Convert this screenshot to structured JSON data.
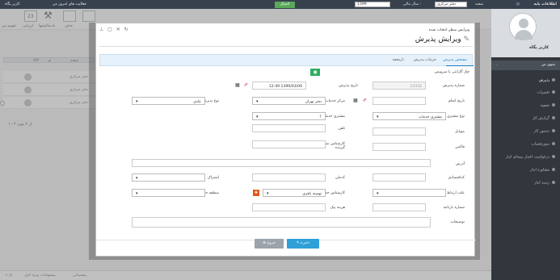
{
  "topbar": {
    "app_title": "اطلاعات پایه",
    "branch_label": "شعبه",
    "branch_value": "دفتر مرکزی",
    "fiscal_label": "سال مالی :",
    "fiscal_value": "1399",
    "green_btn": "اتصال",
    "today_activity": "فعالیت های امروز من",
    "user_short": "کاربر پگاه"
  },
  "sidebar": {
    "username": "کاربر پگاه",
    "menu_title": "منوی من",
    "items": [
      {
        "label": "پذیرش",
        "active": true
      },
      {
        "label": "تعمیرات"
      },
      {
        "label": "تسویه"
      },
      {
        "label": "گزارش کار"
      },
      {
        "label": "دستور کار"
      },
      {
        "label": "صورتحساب"
      },
      {
        "label": "درخواست اعتبار بیمه‌ای انبار"
      },
      {
        "label": "مشاوره انبار"
      },
      {
        "label": "رسید انبار"
      }
    ]
  },
  "toolbar": {
    "tools": [
      "پذیرش جدید",
      "ویرایش",
      "حذف",
      "پادسالمیتها",
      "ارزیابی",
      "تقویم من"
    ],
    "calendar_day": "23"
  },
  "grid": {
    "header": [
      "شعبه",
      "م",
      "VIP"
    ],
    "rows": [
      "دفتر مرکزی",
      "دفتر مرکزی",
      "دفتر مرکزی"
    ],
    "pager": "۱ - ۳ از ۳ مورد"
  },
  "statusbar": {
    "left": "پیشنهادات ویژه لاول",
    "right": "پیشتیبانی"
  },
  "modal": {
    "window_title": "ویرایش سطر انتخاب شده",
    "controls": "⊥ ▢ ✕ ↻",
    "heading": "ویرایش پذیرش",
    "tabs": [
      {
        "label": "مشخص پذیرش",
        "active": true
      },
      {
        "label": "جزئیات پذیرش"
      },
      {
        "label": "تاریخچه"
      }
    ],
    "checklist_label": "چک گارانتی یا سرویس",
    "form": {
      "reception_no_label": "شماره پذیرش",
      "reception_no_value": "13332",
      "reception_date_label": "تاریخ پذیرش",
      "reception_date_value": "12:49 1399/03/06",
      "complete_date_label": "تاریخ اتمام",
      "service_center_label": "مرکز خدمات",
      "service_center_value": "دفتر تهران",
      "reception_type_label": "نوع پذیرش",
      "reception_type_value": "عادی",
      "customer_type_label": "نوع مشتری",
      "customer_type_value": "مشتری خدمات",
      "service_customer_label": "مشتری خدمات",
      "service_customer_value": "؟",
      "mobile_label": "موبایل",
      "phone_label": "تلفن",
      "fax_label": "فاکس",
      "alt_expert_label": "کارشناس تماس گیرنده",
      "address_label": "آدرس",
      "economic_code_label": "کداقتصادی",
      "postal_code_label": "کدملی",
      "subscription_label": "اشتراک",
      "contact_label": "علت ارتباط",
      "service_expert_label": "کارشناس خدمات",
      "service_expert_value": "تهمینه باقری",
      "geo_region_label": "منطقه جغرافیایی",
      "invoice_no_label": "شماره بارنامه",
      "delivery_cost_label": "هزینه پیک",
      "notes_label": "توضیحات"
    },
    "buttons": {
      "save": "ذخیره",
      "exit": "خروج"
    }
  }
}
